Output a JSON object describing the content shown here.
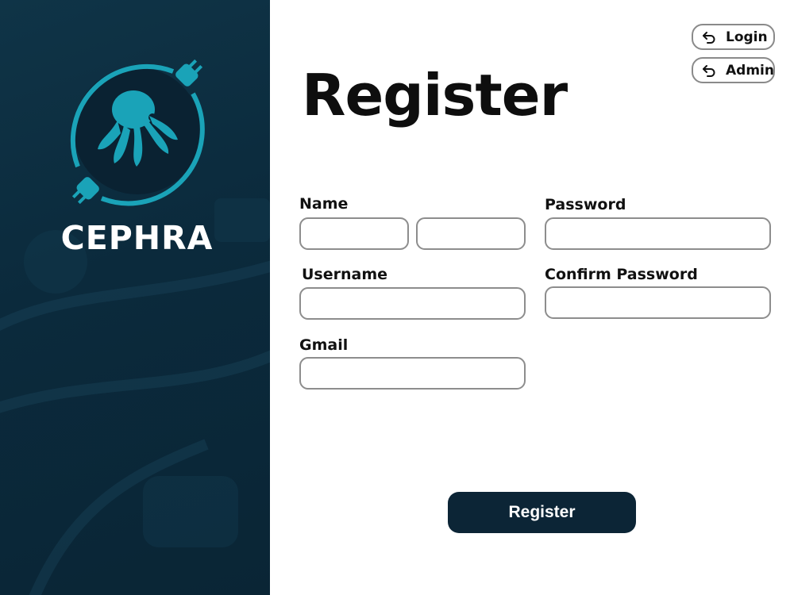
{
  "brand": {
    "name": "CEPHRA"
  },
  "nav": {
    "login_label": "Login",
    "admin_label": "Admin"
  },
  "page": {
    "title": "Register"
  },
  "form": {
    "name_label": "Name",
    "password_label": "Password",
    "username_label": "Username",
    "confirm_password_label": "Confirm Password",
    "gmail_label": "Gmail",
    "values": {
      "first_name": "",
      "last_name": "",
      "password": "",
      "username": "",
      "confirm_password": "",
      "gmail": ""
    },
    "submit_label": "Register"
  },
  "icons": {
    "logo": "octopus-plug-logo-icon",
    "nav": "return-arrow-icon"
  },
  "colors": {
    "panel": "#0b2a3c",
    "accent": "#1aa3b8",
    "button": "#0c2536"
  }
}
